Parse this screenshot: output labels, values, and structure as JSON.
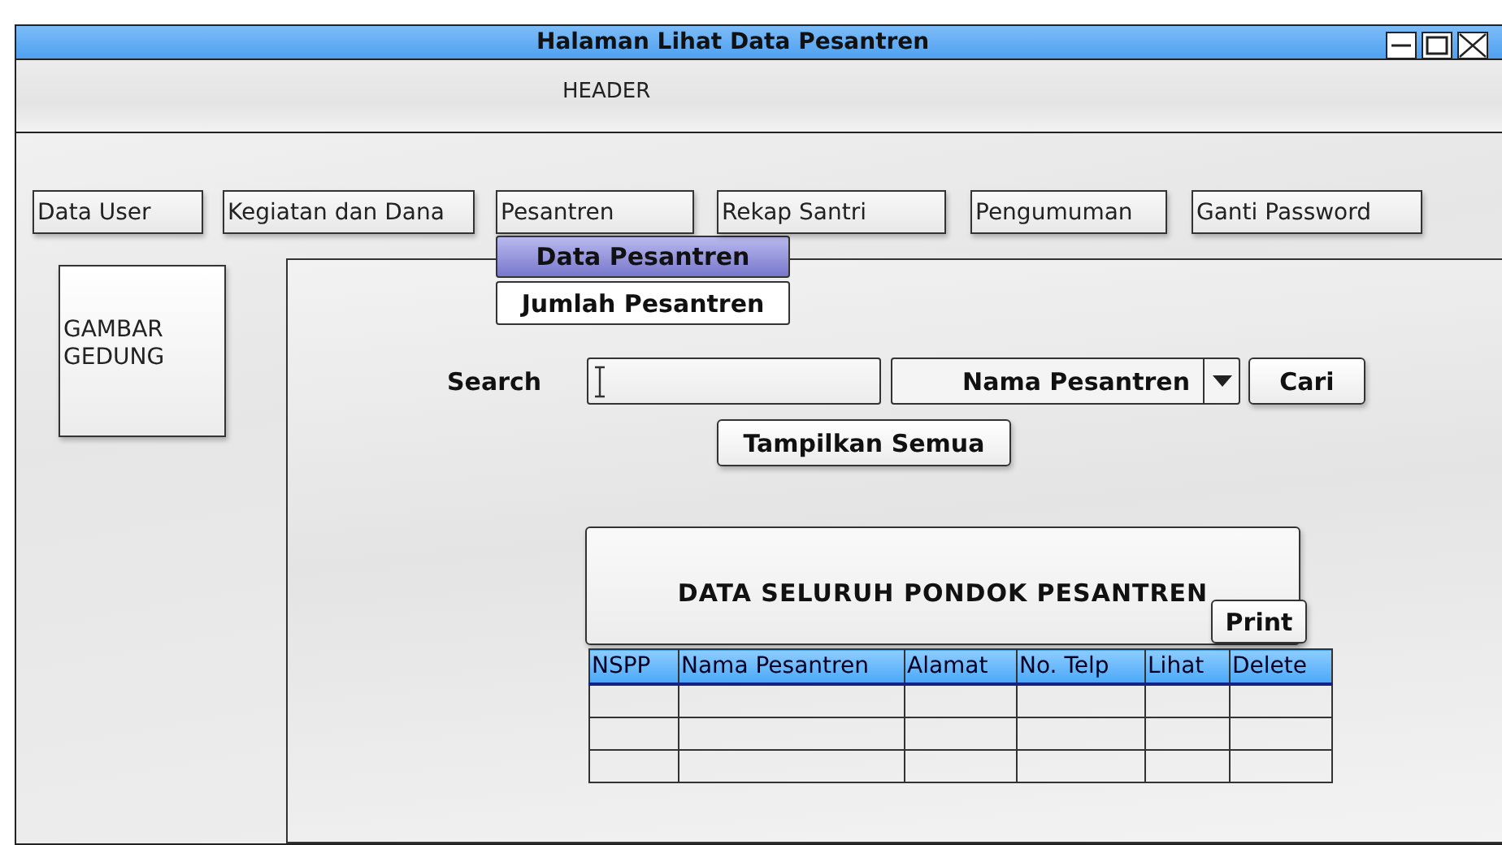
{
  "window": {
    "title": "Halaman Lihat Data Pesantren"
  },
  "header": {
    "text": "HEADER"
  },
  "nav": [
    {
      "label": "Data User"
    },
    {
      "label": "Kegiatan dan Dana"
    },
    {
      "label": "Pesantren",
      "menu": [
        {
          "label": "Data Pesantren",
          "selected": true
        },
        {
          "label": "Jumlah Pesantren",
          "selected": false
        }
      ]
    },
    {
      "label": "Rekap Santri"
    },
    {
      "label": "Pengumuman"
    },
    {
      "label": "Ganti Password"
    }
  ],
  "image_box": {
    "text": "GAMBAR GEDUNG"
  },
  "search": {
    "label": "Search",
    "filter": "Nama Pesantren",
    "button": "Cari"
  },
  "show_all_button": "Tampilkan Semua",
  "table": {
    "title": "DATA SELURUH PONDOK PESANTREN",
    "print_button": "Print",
    "columns": [
      "NSPP",
      "Nama Pesantren",
      "Alamat",
      "No. Telp",
      "Lihat",
      "Delete"
    ],
    "rows": [
      {
        "kind": "blank"
      },
      {
        "kind": "blank"
      },
      {
        "kind": "blank"
      }
    ]
  }
}
